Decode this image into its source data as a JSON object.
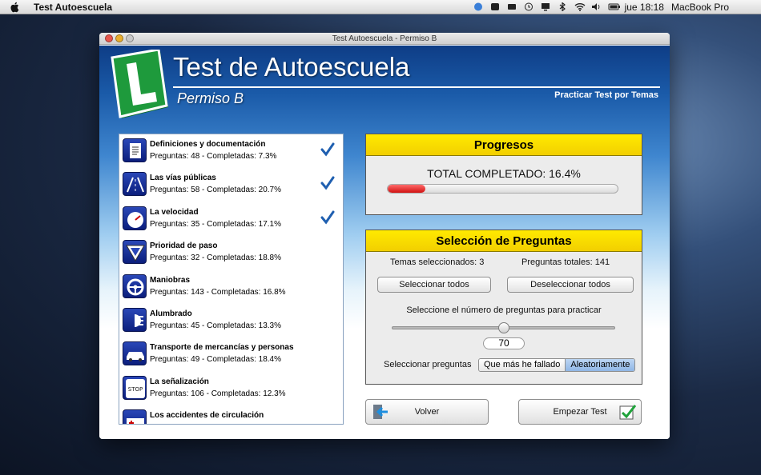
{
  "menubar": {
    "app_name": "Test Autoescuela",
    "clock": "jue 18:18",
    "device": "MacBook Pro"
  },
  "window": {
    "title": "Test Autoescuela - Permiso B"
  },
  "header": {
    "title": "Test de Autoescuela",
    "subtitle": "Permiso B",
    "mode": "Practicar Test por Temas"
  },
  "topics": [
    {
      "name": "Definiciones y documentación",
      "stats": "Preguntas: 48 - Completadas: 7.3%",
      "checked": true,
      "icon": "document-icon"
    },
    {
      "name": "Las vías públicas",
      "stats": "Preguntas: 58 - Completadas: 20.7%",
      "checked": true,
      "icon": "road-icon"
    },
    {
      "name": "La velocidad",
      "stats": "Preguntas: 35 - Completadas: 17.1%",
      "checked": true,
      "icon": "speedometer-icon"
    },
    {
      "name": "Prioridad de paso",
      "stats": "Preguntas: 32 - Completadas: 18.8%",
      "checked": false,
      "icon": "yield-sign-icon"
    },
    {
      "name": "Maniobras",
      "stats": "Preguntas: 143 - Completadas: 16.8%",
      "checked": false,
      "icon": "steering-wheel-icon"
    },
    {
      "name": "Alumbrado",
      "stats": "Preguntas: 45 - Completadas: 13.3%",
      "checked": false,
      "icon": "headlight-icon"
    },
    {
      "name": "Transporte de mercancías y personas",
      "stats": "Preguntas: 49 - Completadas: 18.4%",
      "checked": false,
      "icon": "car-icon"
    },
    {
      "name": "La señalización",
      "stats": "Preguntas: 106 - Completadas: 12.3%",
      "checked": false,
      "icon": "stop-sign-icon"
    },
    {
      "name": "Los accidentes de circulación",
      "stats": "",
      "checked": false,
      "icon": "ambulance-icon"
    }
  ],
  "progress": {
    "header": "Progresos",
    "label": "TOTAL COMPLETADO: 16.4%",
    "fraction": 0.164
  },
  "selection": {
    "header": "Selección de Preguntas",
    "topics_selected": "Temas seleccionados: 3",
    "total_questions": "Preguntas totales: 141",
    "select_all": "Seleccionar todos",
    "deselect_all": "Deseleccionar todos",
    "slider_label": "Seleccione el número de preguntas para practicar",
    "slider_value": "70",
    "slider_fraction": 0.5,
    "mode_label": "Seleccionar preguntas",
    "mode_options": [
      "Que más he fallado",
      "Aleatoriamente"
    ],
    "mode_selected": "Aleatoriamente"
  },
  "actions": {
    "back": "Volver",
    "start": "Empezar Test"
  },
  "colors": {
    "accent_yellow": "#ffe600",
    "progress_red": "#d21212",
    "logo_green": "#1e9a3c",
    "check_blue": "#1f5fb0"
  }
}
